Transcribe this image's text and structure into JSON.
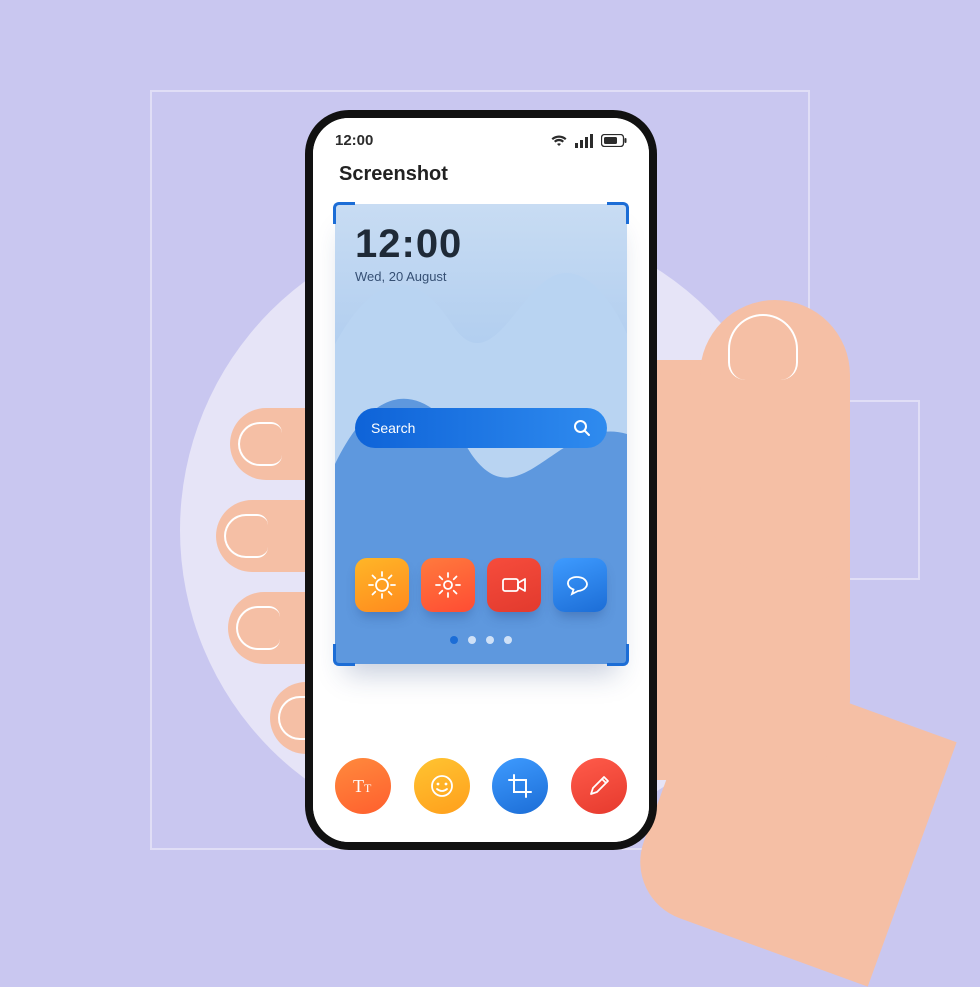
{
  "status": {
    "time": "12:00"
  },
  "header": {
    "title": "Screenshot"
  },
  "preview": {
    "time": "12:00",
    "date": "Wed, 20 August",
    "search_placeholder": "Search",
    "apps": [
      {
        "name": "sun-icon"
      },
      {
        "name": "gear-icon"
      },
      {
        "name": "camera-icon"
      },
      {
        "name": "chat-icon"
      }
    ],
    "page_dots": {
      "count": 4,
      "active_index": 0
    }
  },
  "tools": [
    {
      "name": "text-tool",
      "label": "TT"
    },
    {
      "name": "emoji-tool"
    },
    {
      "name": "crop-tool"
    },
    {
      "name": "draw-tool"
    }
  ],
  "colors": {
    "accent_blue": "#1C6DD6",
    "bg_lavender": "#C9C7F0"
  }
}
